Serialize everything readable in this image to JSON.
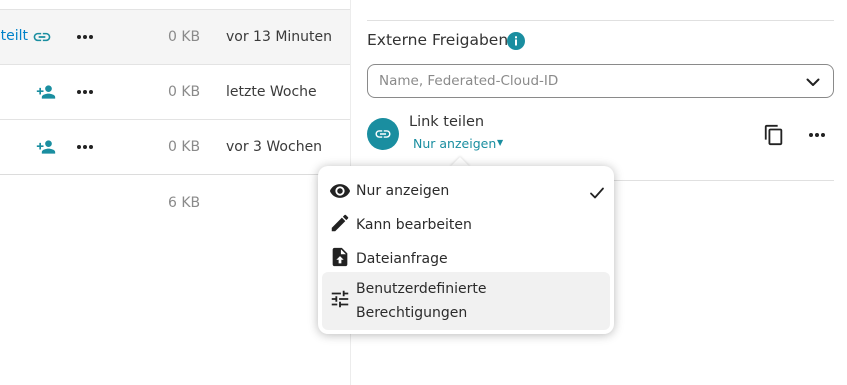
{
  "file_list": {
    "rows": [
      {
        "share_label": "eteilt",
        "share_icon": "link-icon",
        "size": "0 KB",
        "modified": "vor 13 Minuten"
      },
      {
        "share_label": "",
        "share_icon": "add-user-icon",
        "size": "0 KB",
        "modified": "letzte Woche"
      },
      {
        "share_label": "",
        "share_icon": "add-user-icon",
        "size": "0 KB",
        "modified": "vor 3 Wochen"
      }
    ],
    "summary": {
      "size": "6 KB"
    }
  },
  "sidebar": {
    "external_shares_title": "Externe Freigaben",
    "search": {
      "placeholder": "Name, Federated-Cloud-ID",
      "value": ""
    },
    "link_share": {
      "title": "Link teilen",
      "permission": "Nur anzeigen"
    }
  },
  "permission_menu": {
    "items": [
      {
        "label": "Nur anzeigen",
        "icon": "eye-icon",
        "selected": true
      },
      {
        "label": "Kann bearbeiten",
        "icon": "pencil-icon",
        "selected": false
      },
      {
        "label": "Dateianfrage",
        "icon": "file-upload-icon",
        "selected": false
      },
      {
        "label": "Benutzerdefinierte\nBerechtigungen",
        "icon": "tune-icon",
        "selected": false
      }
    ]
  },
  "colors": {
    "accent": "#1a8ea0",
    "link_blue": "#0082c9",
    "selected_row_bg": "#f5f5f5",
    "hover_item_bg": "#f1f1f1"
  }
}
